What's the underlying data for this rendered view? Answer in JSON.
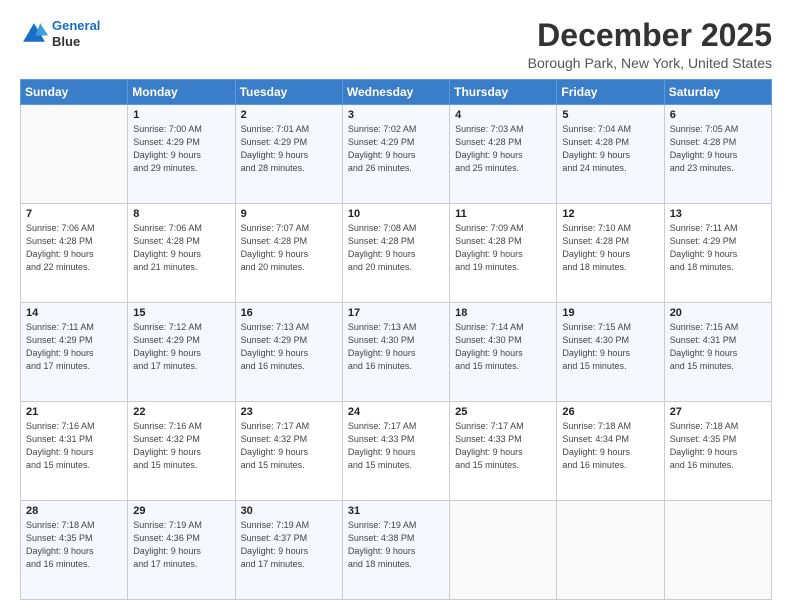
{
  "header": {
    "logo_line1": "General",
    "logo_line2": "Blue",
    "month_title": "December 2025",
    "location": "Borough Park, New York, United States"
  },
  "days_of_week": [
    "Sunday",
    "Monday",
    "Tuesday",
    "Wednesday",
    "Thursday",
    "Friday",
    "Saturday"
  ],
  "weeks": [
    [
      {
        "day": "",
        "info": ""
      },
      {
        "day": "1",
        "info": "Sunrise: 7:00 AM\nSunset: 4:29 PM\nDaylight: 9 hours\nand 29 minutes."
      },
      {
        "day": "2",
        "info": "Sunrise: 7:01 AM\nSunset: 4:29 PM\nDaylight: 9 hours\nand 28 minutes."
      },
      {
        "day": "3",
        "info": "Sunrise: 7:02 AM\nSunset: 4:29 PM\nDaylight: 9 hours\nand 26 minutes."
      },
      {
        "day": "4",
        "info": "Sunrise: 7:03 AM\nSunset: 4:28 PM\nDaylight: 9 hours\nand 25 minutes."
      },
      {
        "day": "5",
        "info": "Sunrise: 7:04 AM\nSunset: 4:28 PM\nDaylight: 9 hours\nand 24 minutes."
      },
      {
        "day": "6",
        "info": "Sunrise: 7:05 AM\nSunset: 4:28 PM\nDaylight: 9 hours\nand 23 minutes."
      }
    ],
    [
      {
        "day": "7",
        "info": "Sunrise: 7:06 AM\nSunset: 4:28 PM\nDaylight: 9 hours\nand 22 minutes."
      },
      {
        "day": "8",
        "info": "Sunrise: 7:06 AM\nSunset: 4:28 PM\nDaylight: 9 hours\nand 21 minutes."
      },
      {
        "day": "9",
        "info": "Sunrise: 7:07 AM\nSunset: 4:28 PM\nDaylight: 9 hours\nand 20 minutes."
      },
      {
        "day": "10",
        "info": "Sunrise: 7:08 AM\nSunset: 4:28 PM\nDaylight: 9 hours\nand 20 minutes."
      },
      {
        "day": "11",
        "info": "Sunrise: 7:09 AM\nSunset: 4:28 PM\nDaylight: 9 hours\nand 19 minutes."
      },
      {
        "day": "12",
        "info": "Sunrise: 7:10 AM\nSunset: 4:28 PM\nDaylight: 9 hours\nand 18 minutes."
      },
      {
        "day": "13",
        "info": "Sunrise: 7:11 AM\nSunset: 4:29 PM\nDaylight: 9 hours\nand 18 minutes."
      }
    ],
    [
      {
        "day": "14",
        "info": "Sunrise: 7:11 AM\nSunset: 4:29 PM\nDaylight: 9 hours\nand 17 minutes."
      },
      {
        "day": "15",
        "info": "Sunrise: 7:12 AM\nSunset: 4:29 PM\nDaylight: 9 hours\nand 17 minutes."
      },
      {
        "day": "16",
        "info": "Sunrise: 7:13 AM\nSunset: 4:29 PM\nDaylight: 9 hours\nand 16 minutes."
      },
      {
        "day": "17",
        "info": "Sunrise: 7:13 AM\nSunset: 4:30 PM\nDaylight: 9 hours\nand 16 minutes."
      },
      {
        "day": "18",
        "info": "Sunrise: 7:14 AM\nSunset: 4:30 PM\nDaylight: 9 hours\nand 15 minutes."
      },
      {
        "day": "19",
        "info": "Sunrise: 7:15 AM\nSunset: 4:30 PM\nDaylight: 9 hours\nand 15 minutes."
      },
      {
        "day": "20",
        "info": "Sunrise: 7:15 AM\nSunset: 4:31 PM\nDaylight: 9 hours\nand 15 minutes."
      }
    ],
    [
      {
        "day": "21",
        "info": "Sunrise: 7:16 AM\nSunset: 4:31 PM\nDaylight: 9 hours\nand 15 minutes."
      },
      {
        "day": "22",
        "info": "Sunrise: 7:16 AM\nSunset: 4:32 PM\nDaylight: 9 hours\nand 15 minutes."
      },
      {
        "day": "23",
        "info": "Sunrise: 7:17 AM\nSunset: 4:32 PM\nDaylight: 9 hours\nand 15 minutes."
      },
      {
        "day": "24",
        "info": "Sunrise: 7:17 AM\nSunset: 4:33 PM\nDaylight: 9 hours\nand 15 minutes."
      },
      {
        "day": "25",
        "info": "Sunrise: 7:17 AM\nSunset: 4:33 PM\nDaylight: 9 hours\nand 15 minutes."
      },
      {
        "day": "26",
        "info": "Sunrise: 7:18 AM\nSunset: 4:34 PM\nDaylight: 9 hours\nand 16 minutes."
      },
      {
        "day": "27",
        "info": "Sunrise: 7:18 AM\nSunset: 4:35 PM\nDaylight: 9 hours\nand 16 minutes."
      }
    ],
    [
      {
        "day": "28",
        "info": "Sunrise: 7:18 AM\nSunset: 4:35 PM\nDaylight: 9 hours\nand 16 minutes."
      },
      {
        "day": "29",
        "info": "Sunrise: 7:19 AM\nSunset: 4:36 PM\nDaylight: 9 hours\nand 17 minutes."
      },
      {
        "day": "30",
        "info": "Sunrise: 7:19 AM\nSunset: 4:37 PM\nDaylight: 9 hours\nand 17 minutes."
      },
      {
        "day": "31",
        "info": "Sunrise: 7:19 AM\nSunset: 4:38 PM\nDaylight: 9 hours\nand 18 minutes."
      },
      {
        "day": "",
        "info": ""
      },
      {
        "day": "",
        "info": ""
      },
      {
        "day": "",
        "info": ""
      }
    ]
  ]
}
